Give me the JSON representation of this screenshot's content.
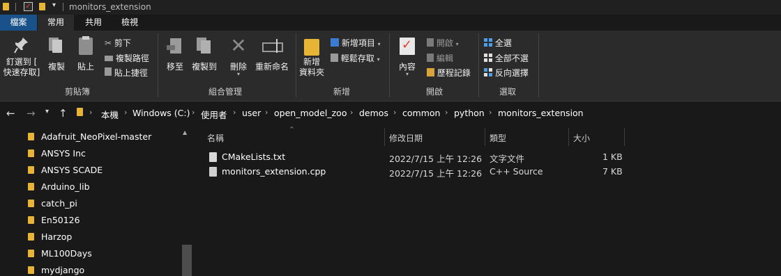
{
  "window": {
    "title": "monitors_extension"
  },
  "tabs": [
    {
      "label": "檔案"
    },
    {
      "label": "常用"
    },
    {
      "label": "共用"
    },
    {
      "label": "檢視"
    }
  ],
  "ribbon": {
    "clipboard": {
      "pin_label_1": "釘選到 [",
      "pin_label_2": "快速存取]",
      "copy_label": "複製",
      "paste_label": "貼上",
      "cut_label": "剪下",
      "copy_path_label": "複製路徑",
      "paste_shortcut_label": "貼上捷徑",
      "group_label": "剪貼簿"
    },
    "organize": {
      "move_label": "移至",
      "copy_to_label": "複製到",
      "delete_label": "刪除",
      "rename_label": "重新命名",
      "group_label": "組合管理"
    },
    "new": {
      "new_folder_label_1": "新增",
      "new_folder_label_2": "資料夾",
      "new_item_label": "新增項目",
      "easy_access_label": "輕鬆存取",
      "group_label": "新增"
    },
    "open": {
      "properties_label": "內容",
      "open_label": "開啟",
      "edit_label": "編輯",
      "history_label": "歷程記錄",
      "group_label": "開啟"
    },
    "select": {
      "select_all_label": "全選",
      "select_none_label": "全部不選",
      "invert_label": "反向選擇",
      "group_label": "選取"
    }
  },
  "address": {
    "breadcrumbs": [
      "本機",
      "Windows (C:)",
      "使用者",
      "user",
      "open_model_zoo",
      "demos",
      "common",
      "python",
      "monitors_extension"
    ]
  },
  "tree": {
    "items": [
      "Adafruit_NeoPixel-master",
      "ANSYS Inc",
      "ANSYS SCADE",
      "Arduino_lib",
      "catch_pi",
      "En50126",
      "Harzop",
      "ML100Days",
      "mydjango"
    ]
  },
  "files": {
    "columns": {
      "name": "名稱",
      "modified": "修改日期",
      "type": "類型",
      "size": "大小"
    },
    "rows": [
      {
        "name": "CMakeLists.txt",
        "modified": "2022/7/15 上午 12:26",
        "type": "文字文件",
        "size": "1 KB"
      },
      {
        "name": "monitors_extension.cpp",
        "modified": "2022/7/15 上午 12:26",
        "type": "C++ Source",
        "size": "7 KB"
      }
    ]
  },
  "colors": {
    "accent": "#19518a",
    "folder": "#e8b436",
    "background": "#191919",
    "ribbon": "#2b2b2b"
  }
}
